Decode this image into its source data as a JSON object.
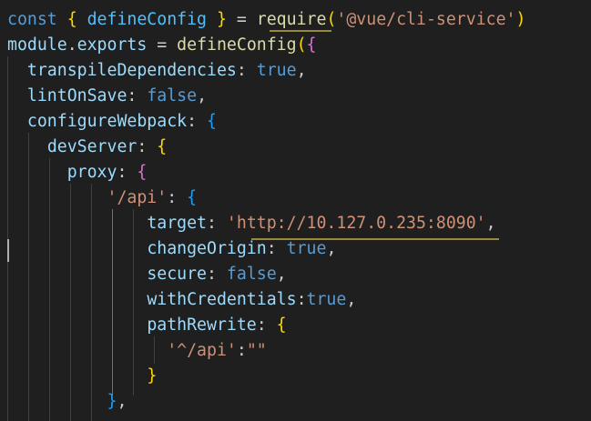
{
  "editor": {
    "language": "javascript",
    "colors": {
      "background": "#1f1f1f",
      "keyword": "#569cd6",
      "function": "#dcdcaa",
      "property": "#9cdcfe",
      "constant": "#4fc1ff",
      "string": "#ce9178",
      "punctuation": "#cccccc",
      "bracket_level_1": "#ffd700",
      "bracket_level_2": "#da70d6",
      "bracket_level_3": "#179fff"
    },
    "cursor_line": 10,
    "lines": [
      {
        "tokens": [
          {
            "text": "const",
            "cls": "kw"
          },
          {
            "text": " ",
            "cls": "pun"
          },
          {
            "text": "{",
            "cls": "b1"
          },
          {
            "text": " ",
            "cls": "pun"
          },
          {
            "text": "defineConfig",
            "cls": "cst"
          },
          {
            "text": " ",
            "cls": "pun"
          },
          {
            "text": "}",
            "cls": "b1"
          },
          {
            "text": " = ",
            "cls": "pun"
          },
          {
            "text": "require",
            "cls": "fn"
          },
          {
            "text": "(",
            "cls": "b1"
          },
          {
            "text": "'@vue/cli-service'",
            "cls": "str"
          },
          {
            "text": ")",
            "cls": "b1"
          }
        ]
      },
      {
        "tokens": [
          {
            "text": "module",
            "cls": "var"
          },
          {
            "text": ".",
            "cls": "pun"
          },
          {
            "text": "exports",
            "cls": "var"
          },
          {
            "text": " = ",
            "cls": "pun"
          },
          {
            "text": "defineConfig",
            "cls": "fn"
          },
          {
            "text": "(",
            "cls": "b1"
          },
          {
            "text": "{",
            "cls": "b2"
          }
        ]
      },
      {
        "tokens": [
          {
            "text": "  ",
            "cls": "pun"
          },
          {
            "text": "transpileDependencies",
            "cls": "var"
          },
          {
            "text": ": ",
            "cls": "pun"
          },
          {
            "text": "true",
            "cls": "kw"
          },
          {
            "text": ",",
            "cls": "pun"
          }
        ]
      },
      {
        "tokens": [
          {
            "text": "  ",
            "cls": "pun"
          },
          {
            "text": "lintOnSave",
            "cls": "var"
          },
          {
            "text": ": ",
            "cls": "pun"
          },
          {
            "text": "false",
            "cls": "kw"
          },
          {
            "text": ",",
            "cls": "pun"
          }
        ]
      },
      {
        "tokens": [
          {
            "text": "  ",
            "cls": "pun"
          },
          {
            "text": "configureWebpack",
            "cls": "var"
          },
          {
            "text": ": ",
            "cls": "pun"
          },
          {
            "text": "{",
            "cls": "b3"
          }
        ]
      },
      {
        "tokens": [
          {
            "text": "    ",
            "cls": "pun"
          },
          {
            "text": "devServer",
            "cls": "var"
          },
          {
            "text": ": ",
            "cls": "pun"
          },
          {
            "text": "{",
            "cls": "b1"
          }
        ]
      },
      {
        "tokens": [
          {
            "text": "      ",
            "cls": "pun"
          },
          {
            "text": "proxy",
            "cls": "var"
          },
          {
            "text": ": ",
            "cls": "pun"
          },
          {
            "text": "{",
            "cls": "b2"
          }
        ]
      },
      {
        "tokens": [
          {
            "text": "          ",
            "cls": "pun"
          },
          {
            "text": "'/api'",
            "cls": "str"
          },
          {
            "text": ": ",
            "cls": "pun"
          },
          {
            "text": "{",
            "cls": "b3"
          }
        ]
      },
      {
        "tokens": [
          {
            "text": "              ",
            "cls": "pun"
          },
          {
            "text": "target",
            "cls": "var"
          },
          {
            "text": ": ",
            "cls": "pun"
          },
          {
            "text": "'http://10.127.0.235:8090'",
            "cls": "str"
          },
          {
            "text": ",",
            "cls": "pun"
          }
        ]
      },
      {
        "tokens": [
          {
            "text": "              ",
            "cls": "pun"
          },
          {
            "text": "changeOrigin",
            "cls": "var"
          },
          {
            "text": ": ",
            "cls": "pun"
          },
          {
            "text": "true",
            "cls": "kw"
          },
          {
            "text": ",",
            "cls": "pun"
          }
        ]
      },
      {
        "tokens": [
          {
            "text": "              ",
            "cls": "pun"
          },
          {
            "text": "secure",
            "cls": "var"
          },
          {
            "text": ": ",
            "cls": "pun"
          },
          {
            "text": "false",
            "cls": "kw"
          },
          {
            "text": ",",
            "cls": "pun"
          }
        ]
      },
      {
        "tokens": [
          {
            "text": "              ",
            "cls": "pun"
          },
          {
            "text": "withCredentials",
            "cls": "var"
          },
          {
            "text": ":",
            "cls": "pun"
          },
          {
            "text": "true",
            "cls": "kw"
          },
          {
            "text": ",",
            "cls": "pun"
          }
        ]
      },
      {
        "tokens": [
          {
            "text": "              ",
            "cls": "pun"
          },
          {
            "text": "pathRewrite",
            "cls": "var"
          },
          {
            "text": ": ",
            "cls": "pun"
          },
          {
            "text": "{",
            "cls": "b1"
          }
        ]
      },
      {
        "tokens": [
          {
            "text": "                ",
            "cls": "pun"
          },
          {
            "text": "'^/api'",
            "cls": "str"
          },
          {
            "text": ":",
            "cls": "pun"
          },
          {
            "text": "\"\"",
            "cls": "str"
          }
        ]
      },
      {
        "tokens": [
          {
            "text": "              ",
            "cls": "pun"
          },
          {
            "text": "}",
            "cls": "b1"
          }
        ]
      },
      {
        "tokens": [
          {
            "text": "          ",
            "cls": "pun"
          },
          {
            "text": "}",
            "cls": "b3"
          },
          {
            "text": ",",
            "cls": "pun"
          }
        ]
      }
    ]
  }
}
